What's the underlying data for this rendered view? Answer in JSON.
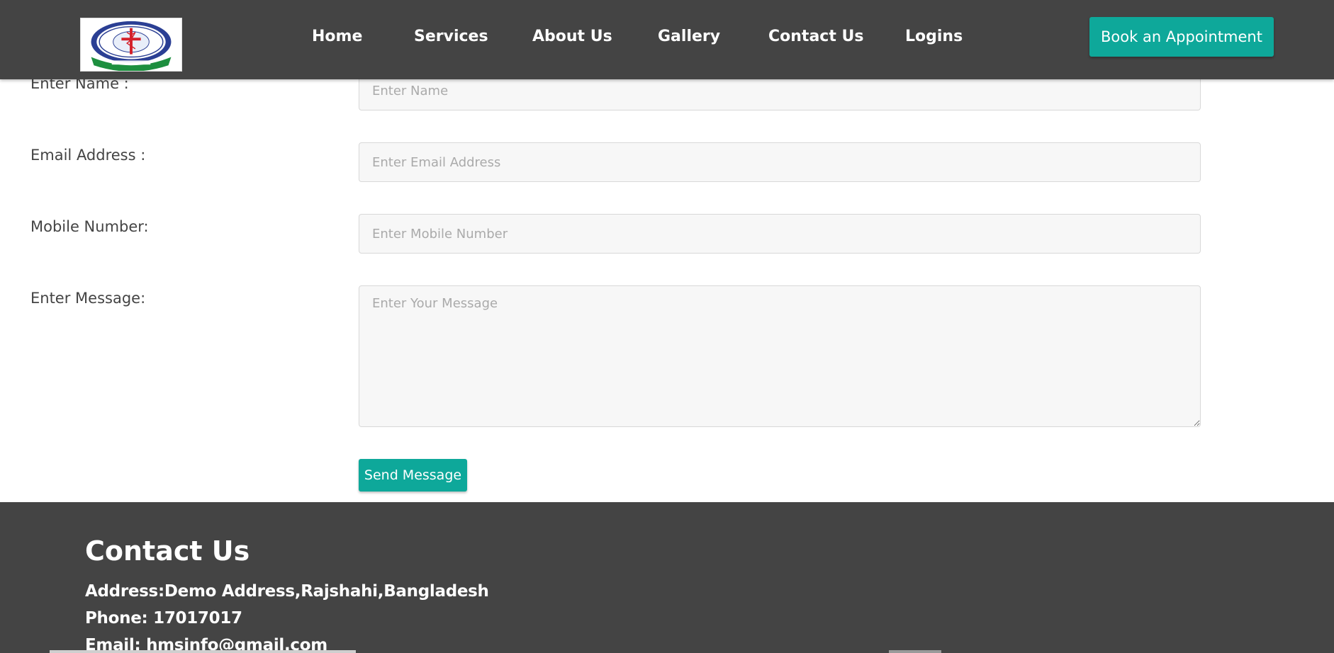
{
  "header": {
    "logo_icon": "medical-college-seal",
    "nav": [
      {
        "label": "Home"
      },
      {
        "label": "Services"
      },
      {
        "label": "About Us"
      },
      {
        "label": "Gallery"
      },
      {
        "label": "Contact Us"
      },
      {
        "label": "Logins"
      }
    ],
    "book_label": "Book an Appointment"
  },
  "form": {
    "name": {
      "label": "Enter Name :",
      "placeholder": "Enter Name",
      "value": ""
    },
    "email": {
      "label": "Email Address :",
      "placeholder": "Enter Email Address",
      "value": ""
    },
    "mobile": {
      "label": "Mobile Number:",
      "placeholder": "Enter Mobile Number",
      "value": ""
    },
    "message": {
      "label": "Enter Message:",
      "placeholder": "Enter Your Message",
      "value": ""
    },
    "send_label": "Send Message"
  },
  "footer": {
    "title": "Contact Us",
    "address": "Address:Demo Address,Rajshahi,Bangladesh",
    "phone": "Phone: 17017017",
    "email": "Email: hmsinfo@gmail.com"
  },
  "colors": {
    "header_bg": "#444444",
    "accent": "#0ea89a",
    "footer_bg": "#444444"
  }
}
